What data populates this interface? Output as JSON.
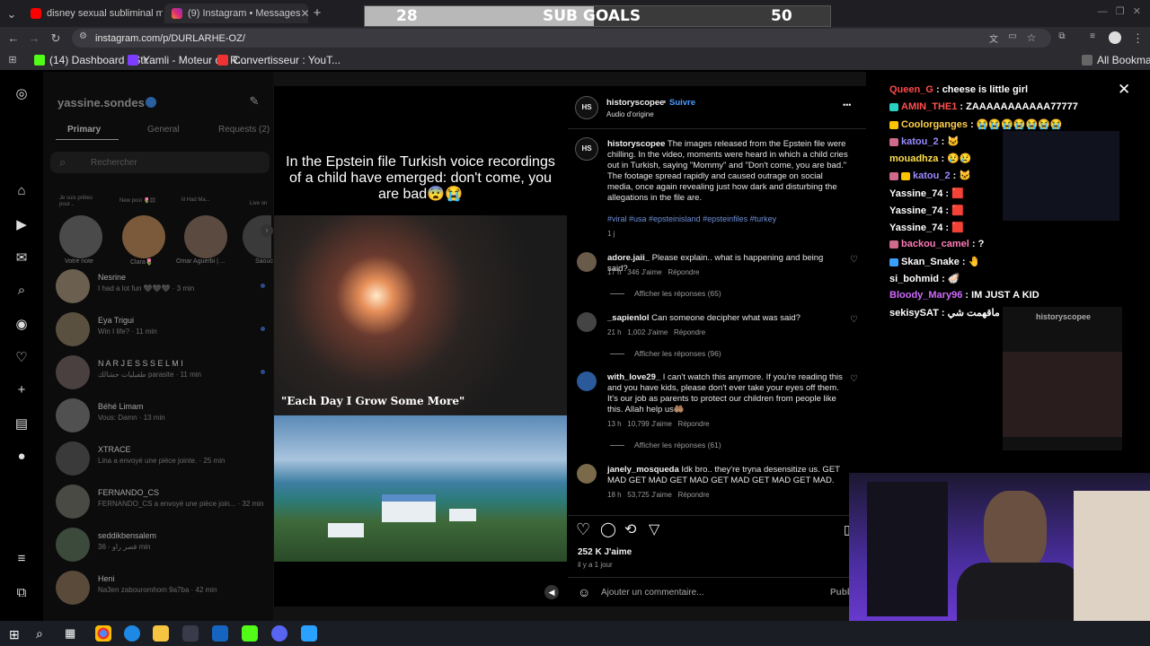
{
  "tabs": [
    {
      "title": "disney sexual subliminal messa",
      "active": false
    },
    {
      "title": "(9) Instagram • Messages",
      "active": true
    }
  ],
  "new_tab_label": "+",
  "url": "instagram.com/p/DURLARHE-OZ/",
  "bookmarks": [
    "(14) Dashboard / Str...",
    "Yamli - Moteur de R...",
    "Convertisseur : YouT..."
  ],
  "all_bookmarks": "All Bookmarks",
  "goals": {
    "current": "28",
    "label": "SUB GOALS",
    "target": "50",
    "progress": 0.56
  },
  "dm": {
    "username": "yassine.sondes",
    "tabs": [
      "Primary",
      "General",
      "Requests (2)"
    ],
    "search_placeholder": "Rechercher",
    "notes": [
      {
        "name": "Votre note",
        "bubble": "Je suis prêtes pour..."
      },
      {
        "name": "Clara🌷",
        "bubble": "New post 🌷🏽"
      },
      {
        "name": "Omar Aguerbi | ...",
        "bubble": "lil Had Ma..."
      },
      {
        "name": "Saouc",
        "bubble": "Live on"
      }
    ],
    "conversations": [
      {
        "name": "Nesrine",
        "preview": "I had a lot fun 🖤🖤🖤 · 3 min"
      },
      {
        "name": "Eya Trigui",
        "preview": "Win I life? · 11 min"
      },
      {
        "name": "N A R J E S S S E L M I",
        "preview": "طفيليات حشالك parasite · 11 min"
      },
      {
        "name": "Béhé Limam",
        "preview": "Vous: Damn · 13 min"
      },
      {
        "name": "XTRACE",
        "preview": "Lina a envoyé une pièce jointe. · 25 min"
      },
      {
        "name": "FERNANDO_CS",
        "preview": "FERNANDO_CS a envoyé une pièce join... · 32 min"
      },
      {
        "name": "seddikbensalem",
        "preview": "قصر راو · 36 min"
      },
      {
        "name": "Heni",
        "preview": "Na3en zabouromhom 9a7ba · 42 min"
      }
    ]
  },
  "post": {
    "caption_text": "In the Epstein file Turkish voice recordings of a child have emerged: don't come, you are bad😨😭",
    "video_caption": "\"Each Day I Grow Some More\"",
    "author": "historyscopee",
    "avatar_text": "HS",
    "follow": "Suivre",
    "audio": "Audio d'origine",
    "description": "The images released from the Epstein file were chilling. In the video, moments were heard in which a child cries out in Turkish, saying \"Mommy\" and \"Don't come, you are bad.\" The footage spread rapidly and caused outrage on social media, once again revealing just how dark and disturbing the allegations in the file are.",
    "hashtags": "#viral #usa #epsteinisland #epsteinfiles #turkey",
    "desc_time": "1 j",
    "comments": [
      {
        "user": "adore.jaii_",
        "text": "Please explain.. what is happening and being said?",
        "time": "17 h",
        "likes": "346 J'aime",
        "reply": "Répondre",
        "replies": "Afficher les réponses (65)"
      },
      {
        "user": "_sapienlol",
        "text": "Can someone decipher what was said?",
        "time": "21 h",
        "likes": "1,002 J'aime",
        "reply": "Répondre",
        "replies": "Afficher les réponses (96)"
      },
      {
        "user": "with_love29_",
        "text": "I can't watch this anymore. If you're reading this and you have kids, please don't ever take your eyes off them. It's our job as parents to protect our children from people like this. Allah help us🤲🏽",
        "time": "13 h",
        "likes": "10,799 J'aime",
        "reply": "Répondre",
        "replies": "Afficher les réponses (61)"
      },
      {
        "user": "janely_mosqueda",
        "text": "Idk bro.. they're tryna desensitize us. GET MAD GET MAD GET MAD GET MAD GET MAD GET MAD.",
        "time": "18 h",
        "likes": "53,725 J'aime",
        "reply": "Répondre",
        "replies": ""
      }
    ],
    "like_count": "252 K J'aime",
    "post_time": "il y a 1 jour",
    "comment_placeholder": "Ajouter un commentaire...",
    "publish": "Publi",
    "more": "•••",
    "close": "✕"
  },
  "chat": [
    {
      "user": "Queen_G",
      "msg": "cheese is little girl",
      "color": "#ff4a4a"
    },
    {
      "user": "AMIN_THE1",
      "msg": "ZAAAAAAAAAAA77777",
      "color": "#ff5050"
    },
    {
      "user": "Coolorganges",
      "msg": "😭😭😭😭😭😭😭",
      "color": "#ffd04a"
    },
    {
      "user": "katou_2",
      "msg": "🐱",
      "color": "#9a8cff"
    },
    {
      "user": "mouadhza",
      "msg": "😢😢",
      "color": "#ffe04a"
    },
    {
      "user": "katou_2",
      "msg": "🐱",
      "color": "#9a8cff"
    },
    {
      "user": "Yassine_74",
      "msg": "🟥",
      "color": "#ffffff"
    },
    {
      "user": "Yassine_74",
      "msg": "🟥",
      "color": "#ffffff"
    },
    {
      "user": "Yassine_74",
      "msg": "🟥",
      "color": "#ffffff"
    },
    {
      "user": "backou_camel",
      "msg": "?",
      "color": "#ff7ab8"
    },
    {
      "user": "Skan_Snake",
      "msg": "🤚",
      "color": "#ffffff"
    },
    {
      "user": "si_bohmid",
      "msg": "🦪",
      "color": "#ffffff"
    },
    {
      "user": "Bloody_Mary96",
      "msg": "IM JUST A KID",
      "color": "#d06aff"
    },
    {
      "user": "sekisySAT",
      "msg": "ماقهمت شي",
      "color": "#ffffff"
    }
  ],
  "overlay_mini_author": "historyscopee"
}
